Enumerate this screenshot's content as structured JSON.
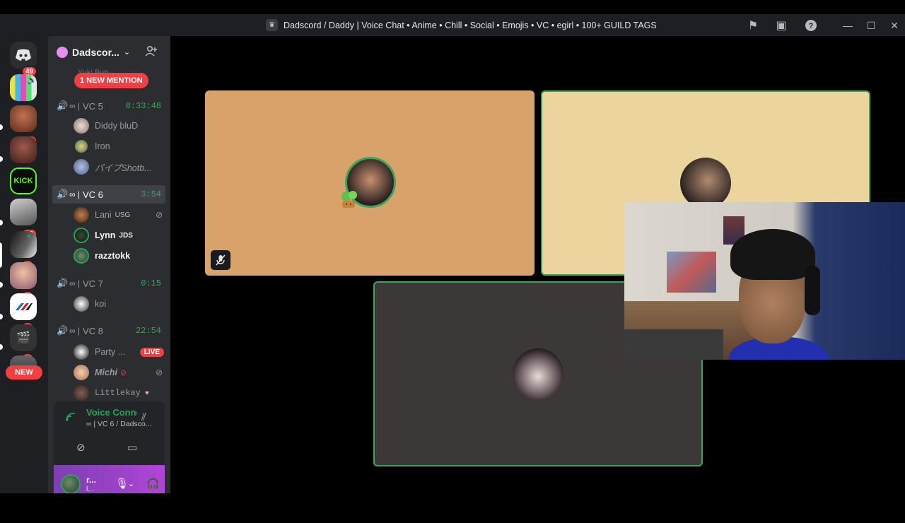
{
  "window": {
    "title": "Dadscord / Daddy | Voice Chat • Anime • Chill • Social • Emojis • VC • egirl • 100+ GUILD TAGS"
  },
  "rail": {
    "home_badge": "49",
    "servers": [
      {
        "badge": "",
        "name": "server-tv"
      },
      {
        "badge": "16",
        "name": "server-face"
      },
      {
        "badge": "",
        "name": "server-red"
      },
      {
        "badge": "",
        "name": "server-kick",
        "label": "KICK"
      },
      {
        "badge": "12",
        "name": "server-grey"
      },
      {
        "badge": "1",
        "name": "server-bw"
      },
      {
        "badge": "6",
        "name": "server-anime"
      },
      {
        "badge": "8",
        "name": "server-flag"
      },
      {
        "badge": "9",
        "name": "server-clap"
      }
    ],
    "new_label": "NEW"
  },
  "sidebar": {
    "server_name": "Dadscor...",
    "mention": "1 NEW MENTION",
    "partial_top": "Yuki Bub",
    "channels": [
      {
        "name": "VC 5",
        "prefix": "∞ |",
        "time": "8:33:48",
        "active": false
      },
      {
        "name": "VC 6",
        "prefix": "∞ |",
        "time": "3:54",
        "active": true
      },
      {
        "name": "VC 7",
        "prefix": "∞ |",
        "time": "0:15",
        "active": false
      },
      {
        "name": "VC 8",
        "prefix": "∞ |",
        "time": "22:54",
        "active": false
      }
    ],
    "vc5_users": [
      "Diddy bluD",
      "Iron",
      "パイプShotb..."
    ],
    "vc6_users": [
      {
        "name": "Lani",
        "tag": "USG"
      },
      {
        "name": "Lynn",
        "tag": "JDS"
      },
      {
        "name": "razztokk",
        "tag": ""
      }
    ],
    "vc7_users": [
      "koi"
    ],
    "vc8_users": [
      {
        "name": "Party ...",
        "live": "LIVE"
      },
      {
        "name": "Michi",
        "live": ""
      },
      {
        "name": "Littlekay",
        "live": ""
      }
    ]
  },
  "voice_panel": {
    "status": "Voice Connected",
    "channel": "∞ | VC 6 / Dadsco..."
  },
  "user_panel": {
    "name": "r...",
    "sub": "l..."
  },
  "colors": {
    "tile1": "#d8a36b",
    "tile2": "#ecd49d",
    "tile3": "#3d3838",
    "speaking": "#3ba55c"
  }
}
